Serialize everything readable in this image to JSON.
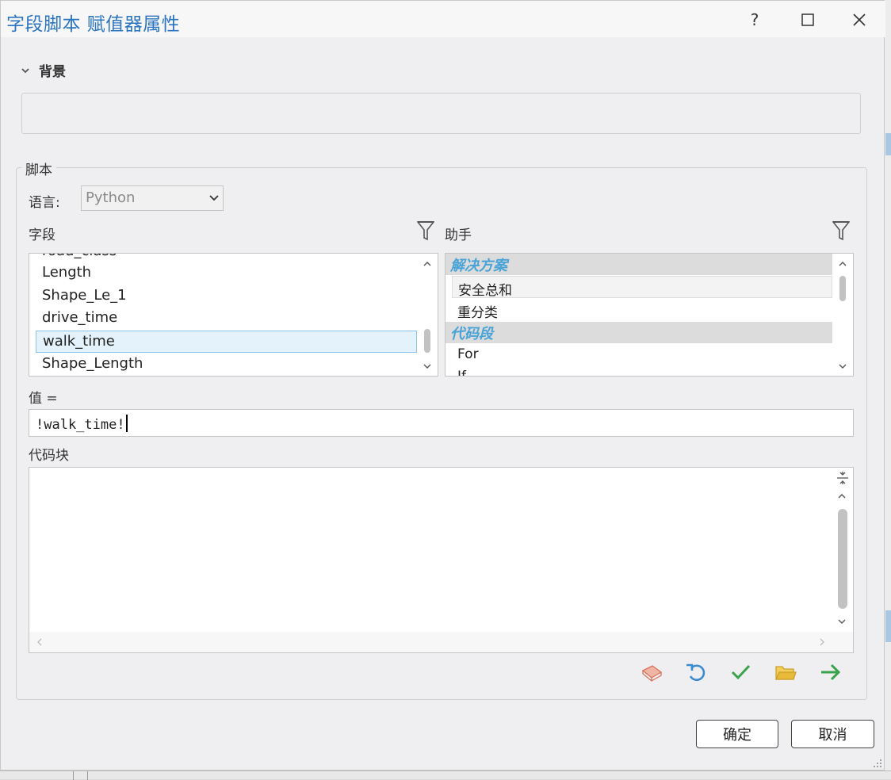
{
  "dialog": {
    "title": "字段脚本 赋值器属性",
    "help_label": "?"
  },
  "description": {
    "section_label": "背景",
    "text": ""
  },
  "script": {
    "group_label": "脚本",
    "language_label": "语言:",
    "language_value": "Python",
    "fields_label": "字段",
    "helper_label": "助手",
    "fields": [
      {
        "label": "road_class",
        "selected": false
      },
      {
        "label": "Length",
        "selected": false
      },
      {
        "label": "Shape_Le_1",
        "selected": false
      },
      {
        "label": "drive_time",
        "selected": false
      },
      {
        "label": "walk_time",
        "selected": true
      },
      {
        "label": "Shape_Length",
        "selected": false
      }
    ],
    "helpers": {
      "category_1": "解决方案",
      "item_1": "安全总和",
      "item_2": "重分类",
      "category_2": "代码段",
      "item_3": "For",
      "item_4": "If"
    },
    "value_label": "值 =",
    "value_expression": "!walk_time!",
    "code_block_label": "代码块",
    "code_block_text": ""
  },
  "toolbar_icons": [
    "book-icon",
    "undo-icon",
    "check-icon",
    "folder-icon",
    "arrow-right-icon"
  ],
  "colors": {
    "title": "#2a74c0",
    "category_text": "#4aa3d6",
    "selection_bg": "#e3f2fb",
    "check": "#3aa24a",
    "arrow": "#3aa24a",
    "folder": "#e2b93a",
    "undo": "#3b8bd0",
    "book": "#e08a72"
  },
  "buttons": {
    "ok": "确定",
    "cancel": "取消"
  }
}
